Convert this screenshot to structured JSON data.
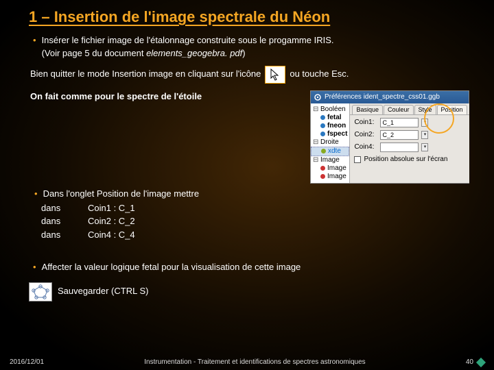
{
  "title": "1 – Insertion de l'image spectrale du Néon",
  "bullet1_a": "Insérer le fichier image de l'étalonnage construite sous le progamme IRIS.",
  "bullet1_b": "(Voir page 5 du document ",
  "bullet1_b_em": "elements_geogebra. pdf",
  "bullet1_b_end": ")",
  "esc_a": "Bien quitter le mode ",
  "esc_b": "Insertion image",
  "esc_c": " en cliquant sur l'icône",
  "esc_d": "ou touche Esc.",
  "spectre": "On fait comme pour le spectre de l'étoile",
  "coins_head": "Dans l'onglet Position de l'image mettre",
  "coins": {
    "r1a": "dans",
    "r1b": "Coin1 : C_1",
    "r2a": "dans",
    "r2b": "Coin2 : C_2",
    "r3a": "dans",
    "r3b": "Coin4 : C_4"
  },
  "affecter_a": "Affecter  la valeur logique  ",
  "affecter_b": "fetal",
  "affecter_c": "  pour la visualisation de cette image",
  "save": "Sauvegarder (CTRL S)",
  "footer": {
    "date": "2016/12/01",
    "mid": "Instrumentation -  Traitement et identifications de spectres astronomiques",
    "page": "40"
  },
  "prefs": {
    "title": "Préférences   ident_spectre_css01.ggb",
    "list": [
      "Booléen",
      "fetal",
      "fneon",
      "fspect",
      "Droite",
      "xdte",
      "Image",
      "Image",
      "Image"
    ],
    "dotcolors": [
      "#2a78c0",
      "#2a78c0",
      "#2a78c0",
      "#2a78c0",
      "#8a2",
      "#8a2",
      "#c33",
      "#c33",
      "#c33"
    ],
    "tabs": [
      "Basique",
      "Couleur",
      "Style",
      "Position"
    ],
    "coin1l": "Coin1:",
    "coin1v": "C_1",
    "coin2l": "Coin2:",
    "coin2v": "C_2",
    "coin4l": "Coin4:",
    "coin4v": "",
    "chk": "Position absolue sur l'écran"
  }
}
